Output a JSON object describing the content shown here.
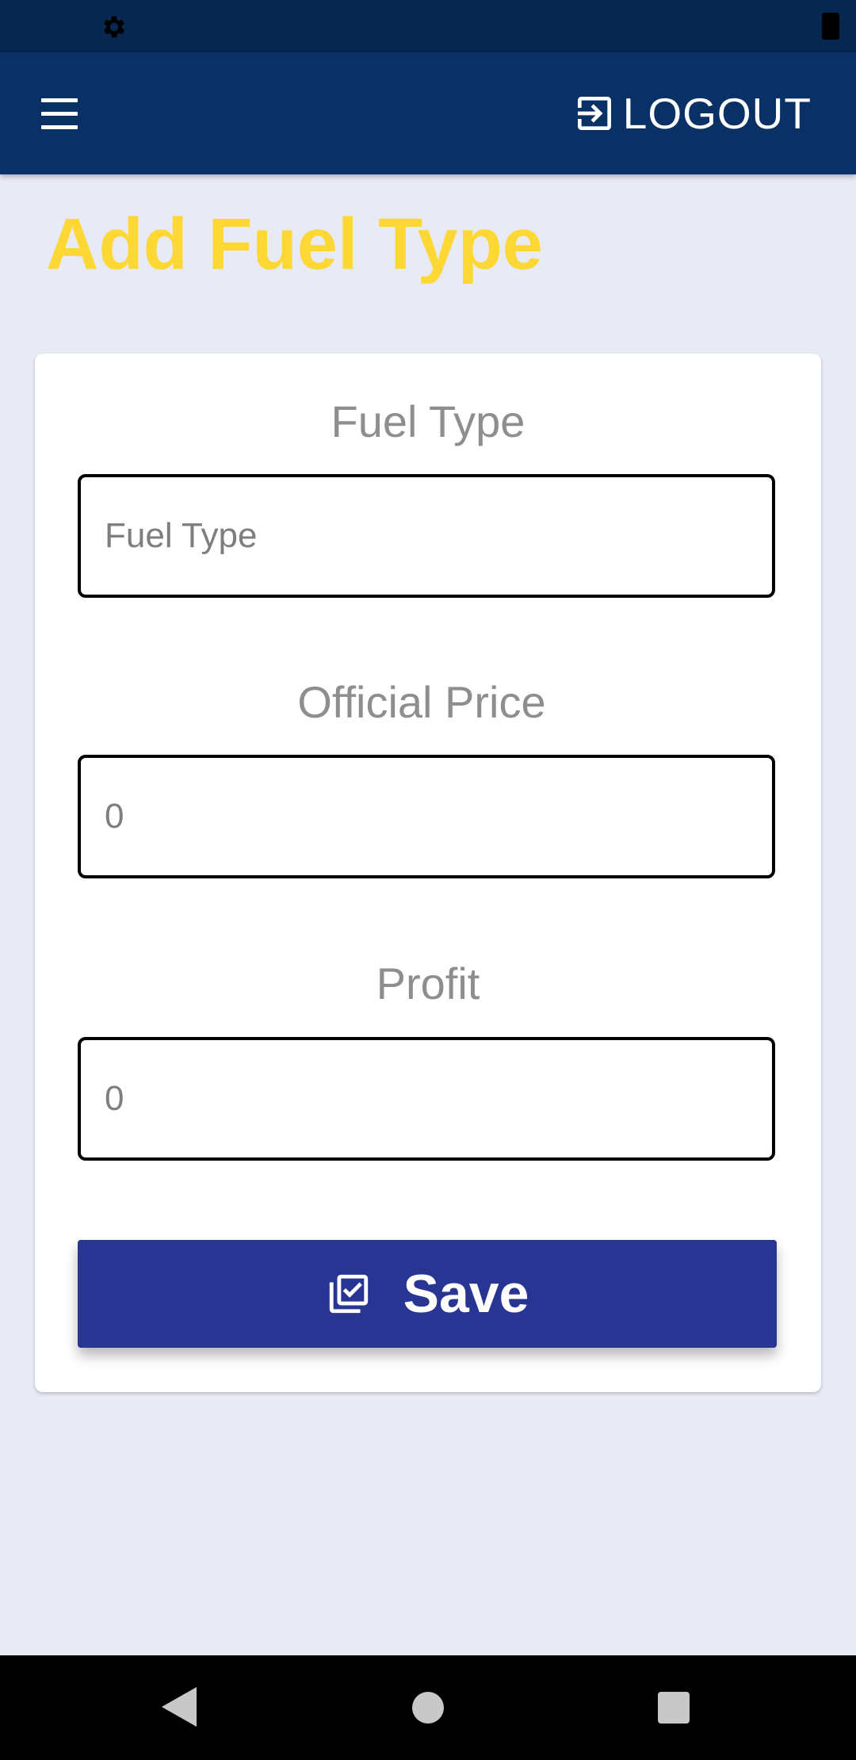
{
  "status_bar": {
    "icons": [
      "gear-icon",
      "battery-icon"
    ]
  },
  "app_bar": {
    "menu_icon": "hamburger-menu-icon",
    "logout_label": "LOGOUT",
    "logout_icon": "logout-icon"
  },
  "page": {
    "title": "Add Fuel Type"
  },
  "form": {
    "fuel_type": {
      "label": "Fuel Type",
      "placeholder": "Fuel Type",
      "value": ""
    },
    "official_price": {
      "label": "Official Price",
      "placeholder": "0",
      "value": ""
    },
    "profit": {
      "label": "Profit",
      "placeholder": "0",
      "value": ""
    },
    "save_label": "Save",
    "save_icon": "save-library-check-icon"
  },
  "nav_bar": {
    "icons": [
      "back-icon",
      "home-icon",
      "recents-icon"
    ]
  },
  "colors": {
    "status_bar": "#072650",
    "app_bar": "#0a3166",
    "title": "#fdd835",
    "button": "#283593",
    "background": "#e8eaf6"
  }
}
